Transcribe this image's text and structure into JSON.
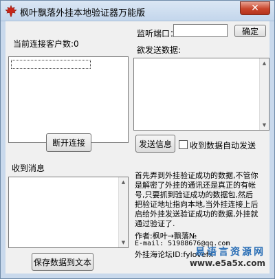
{
  "window": {
    "title": "枫叶飘落外挂本地验证器万能版",
    "close_glyph": "✕"
  },
  "connection": {
    "client_count_label": "当前连接客户数:0",
    "disconnect_label": "断开连接"
  },
  "listen": {
    "port_label": "监听端口：",
    "port_value": "",
    "confirm_label": "确定"
  },
  "send": {
    "label": "欲发送数据:",
    "button_label": "发送信息",
    "auto_send_label": "收到数据自动发送",
    "auto_send_checked": false
  },
  "receive": {
    "label": "收到消息",
    "save_button_label": "保存数据到文本"
  },
  "notes": {
    "text": "首先弄到外挂验证成功的数据,不管你是解密了外挂的通讯还是真正的有帐号,只要抓到验证成功的数据包,然后把验证地址指向本地,当外挂连接上后启给外挂发送验证成功的数据,外挂就通过验证了."
  },
  "credits": {
    "author": "作者:枫叶→飘落№",
    "email": "E-mail: 51988676@qq.com",
    "forum": "外挂海论坛ID:fylovefx"
  },
  "watermark": {
    "site_name": "易语言资源网",
    "url": "www.e5a5x.com"
  },
  "colors": {
    "accent_blue": "#2b6fb6",
    "close_red": "#c9462c",
    "app_icon_red": "#c8261a"
  },
  "icons": {
    "app": "maple-leaf-icon",
    "close": "close-icon"
  }
}
